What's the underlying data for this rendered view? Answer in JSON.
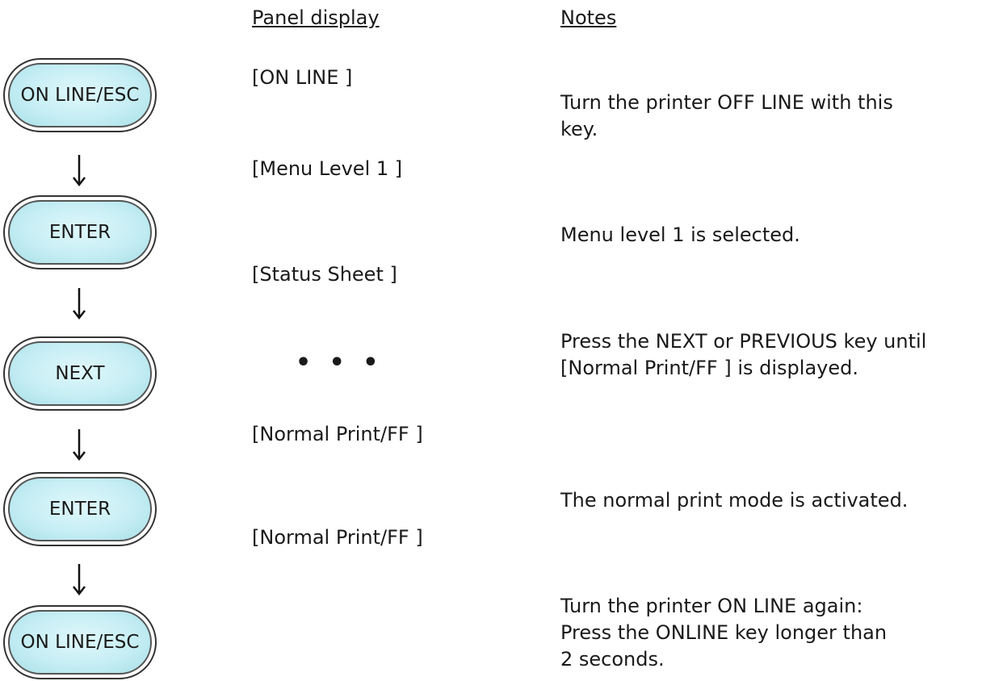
{
  "headings": {
    "panel_display": "Panel display",
    "notes": "Notes"
  },
  "keys": [
    {
      "label": "ON LINE/ESC"
    },
    {
      "label": "ENTER"
    },
    {
      "label": "NEXT"
    },
    {
      "label": "ENTER"
    },
    {
      "label": "ON LINE/ESC"
    }
  ],
  "displays": [
    "[ON LINE ]",
    "[Menu Level 1 ]",
    "[Status Sheet ]",
    "[Normal Print/FF ]",
    "[Normal Print/FF ]"
  ],
  "ellipsis": "• • •",
  "notes": [
    {
      "lines": [
        "Turn the printer OFF LINE with this",
        "key."
      ]
    },
    {
      "lines": [
        "Menu level 1 is selected."
      ]
    },
    {
      "lines": [
        "Press the NEXT or PREVIOUS key until",
        "[Normal Print/FF ] is displayed."
      ]
    },
    {
      "lines": [
        "The normal print mode is activated."
      ]
    },
    {
      "lines": [
        "Turn the printer ON LINE again:",
        "Press the ONLINE key longer than",
        "2 seconds."
      ]
    }
  ],
  "colors": {
    "key_fill": "#c6eef4",
    "key_border": "#333333",
    "text": "#1a1a1a"
  }
}
